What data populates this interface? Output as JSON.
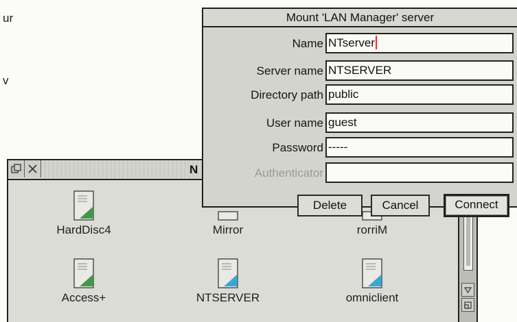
{
  "backdrop": {
    "text1": "ur",
    "text2": "v"
  },
  "filer": {
    "title": "N",
    "icons": [
      {
        "label": "HardDisc4",
        "kind": "harddisc"
      },
      {
        "label": "Mirror",
        "kind": "server"
      },
      {
        "label": "rorriM",
        "kind": "server"
      },
      {
        "label": "Access+",
        "kind": "harddisc"
      },
      {
        "label": "NTSERVER",
        "kind": "lanman-server"
      },
      {
        "label": "omniclient",
        "kind": "lanman-server"
      }
    ]
  },
  "dialog": {
    "title": "Mount 'LAN Manager' server",
    "fields": {
      "name": {
        "label": "Name",
        "value": "NTserver"
      },
      "server_name": {
        "label": "Server name",
        "value": "NTSERVER"
      },
      "directory_path": {
        "label": "Directory path",
        "value": "public"
      },
      "user_name": {
        "label": "User name",
        "value": "guest"
      },
      "password": {
        "label": "Password",
        "value": "-----"
      },
      "authenticator": {
        "label": "Authenticator",
        "value": ""
      }
    },
    "buttons": {
      "delete": "Delete",
      "cancel": "Cancel",
      "connect": "Connect"
    }
  },
  "colors": {
    "dialog_bg": "#d4d4cf",
    "field_bg": "#fafaf6",
    "caret": "#dd3333",
    "disc_green": "#3e9a46",
    "server_blue": "#3aa6d6"
  }
}
